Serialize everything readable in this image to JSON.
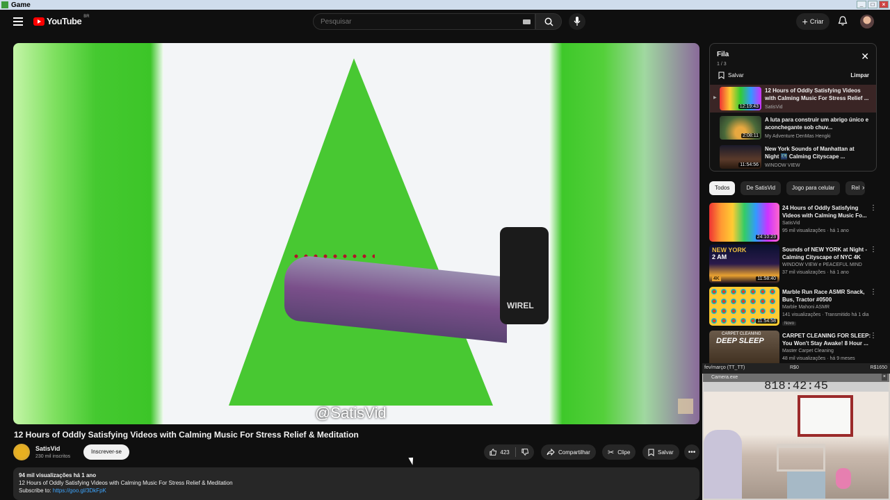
{
  "window": {
    "title": "Game",
    "buttons": [
      "_",
      "□",
      "×"
    ]
  },
  "header": {
    "logo_text": "YouTube",
    "country_code": "BR",
    "search_placeholder": "Pesquisar",
    "create_label": "Criar"
  },
  "player": {
    "watermark": "@SatisVid",
    "device_text": "WIREL"
  },
  "video": {
    "title": "12 Hours of Oddly Satisfying Videos with Calming Music For Stress Relief & Meditation",
    "channel": "SatisVid",
    "subscribers": "230 mil inscritos",
    "subscribe_label": "Inscrever-se",
    "likes": "423",
    "share_label": "Compartilhar",
    "clip_label": "Clipe",
    "save_label": "Salvar",
    "description": {
      "views_time": "94 mil visualizações  há 1 ano",
      "line1": "12 Hours of Oddly Satisfying Videos with Calming Music For Stress Relief & Meditation",
      "subscribe_prefix": "Subscribe to: ",
      "subscribe_link": "https://goo.gl/3DkFpK"
    }
  },
  "queue": {
    "title": "Fila",
    "count": "1 / 3",
    "save_label": "Salvar",
    "clear_label": "Limpar",
    "items": [
      {
        "title": "12 Hours of Oddly Satisfying Videos with Calming Music For Stress Relief ...",
        "channel": "SatisVid",
        "duration": "12:19:43"
      },
      {
        "title": "A luta para construir um abrigo único e aconchegante sob chuv...",
        "channel": "My Adventure DenMas Hengki",
        "duration": "2:08:11"
      },
      {
        "title": "New York Sounds of Manhattan at Night 🌃 Calming Cityscape ...",
        "channel": "WINDOW VIEW",
        "duration": "11:54:56"
      }
    ]
  },
  "chips": [
    "Todos",
    "De SatisVid",
    "Jogo para celular",
    "Rel"
  ],
  "recommendations": [
    {
      "title": "24 Hours of Oddly Satisfying Videos with Calming Music Fo...",
      "channel": "SatisVid",
      "meta": "95 mil visualizações · há 1 ano",
      "duration": "24:10:23",
      "badge": ""
    },
    {
      "title": "Sounds of NEW YORK at Night - Calming Cityscape of NYC 4K",
      "channel": "WINDOW VIEW e PEACEFUL MIND",
      "meta": "37 mil visualizações · há 1 ano",
      "duration": "11:58:40",
      "badge": ""
    },
    {
      "title": "Marble Run Race ASMR Snack, Bus, Tractor #0500",
      "channel": "Marble Mahoni ASMR",
      "meta": "141 visualizações · Transmitido há 1 dia",
      "duration": "11:54:58",
      "badge": "Novo"
    },
    {
      "title": "CARPET CLEANING FOR SLEEP: You Won't Stay Awake! 8 Hour ...",
      "channel": "Master Carpet Cleaning",
      "meta": "48 mil visualizações · há 9 meses",
      "duration": "",
      "badge": ""
    }
  ],
  "rec_thumb_text": {
    "nyc_line1": "NEW YORK",
    "nyc_line2": "2 AM",
    "nyc_badge": "4K",
    "carpet_line1": "CARPET CLEANING",
    "carpet_line2": "DEEP SLEEP"
  },
  "overlay": {
    "label_left": "fev/março (TT_TT)",
    "label_mid": "R$0",
    "label_right": "R$1650",
    "camera_title": "Camera.exe",
    "timer": "818:42:45"
  },
  "colors": {
    "background": "#0f0f0f",
    "accent": "#ff0000",
    "link": "#3ea6ff"
  }
}
